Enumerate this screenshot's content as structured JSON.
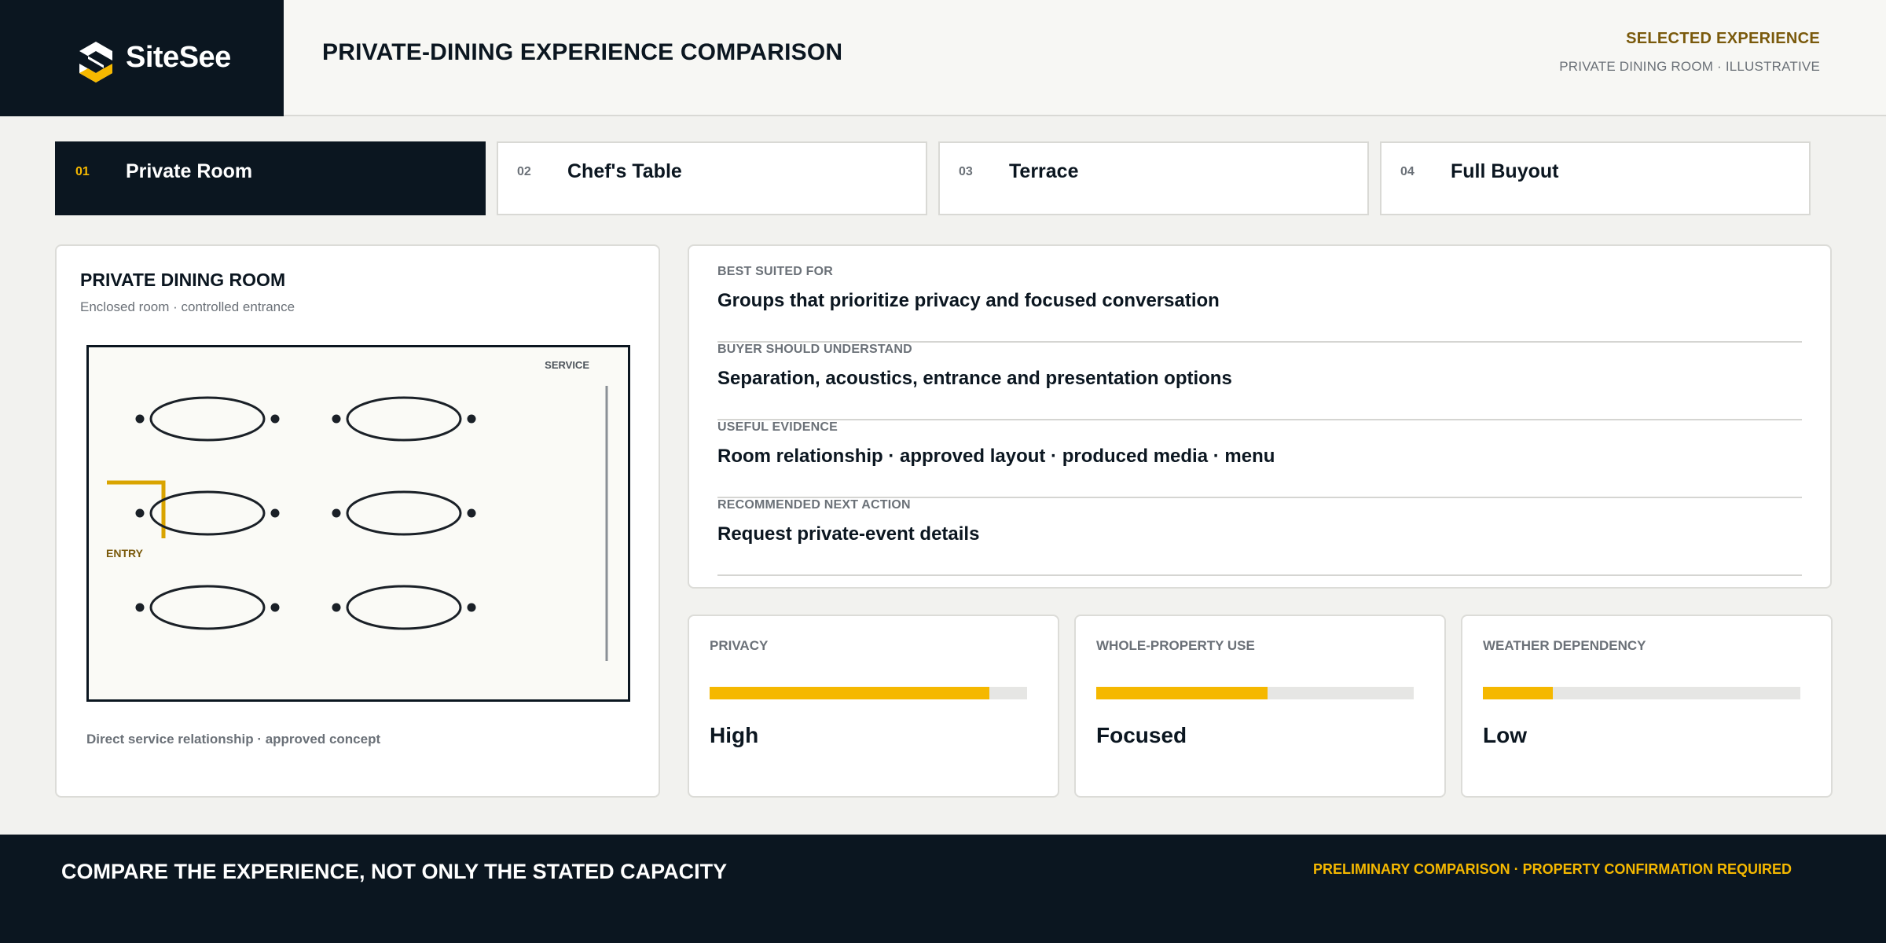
{
  "brand": {
    "name": "SiteSee",
    "logo_icon": "sitesee-logo-icon",
    "accent_color": "#f5b800",
    "dark_color": "#0b1620"
  },
  "header": {
    "title": "PRIVATE-DINING EXPERIENCE COMPARISON",
    "selected_label": "SELECTED EXPERIENCE",
    "selected_sub": "PRIVATE DINING ROOM · ILLUSTRATIVE"
  },
  "tabs": [
    {
      "num": "01",
      "label": "Private Room",
      "active": true
    },
    {
      "num": "02",
      "label": "Chef's Table",
      "active": false
    },
    {
      "num": "03",
      "label": "Terrace",
      "active": false
    },
    {
      "num": "04",
      "label": "Full Buyout",
      "active": false
    }
  ],
  "room": {
    "title": "PRIVATE DINING ROOM",
    "subtitle": "Enclosed room · controlled entrance",
    "caption": "Direct service relationship · approved concept",
    "plan": {
      "service_label": "SERVICE",
      "entry_label": "ENTRY"
    }
  },
  "info": [
    {
      "label": "BEST SUITED FOR",
      "value": "Groups that prioritize privacy and focused conversation"
    },
    {
      "label": "BUYER SHOULD UNDERSTAND",
      "value": "Separation, acoustics, entrance and presentation options"
    },
    {
      "label": "USEFUL EVIDENCE",
      "value": "Room relationship · approved layout · produced media · menu"
    },
    {
      "label": "RECOMMENDED NEXT ACTION",
      "value": "Request private-event details"
    }
  ],
  "metrics": [
    {
      "label": "PRIVACY",
      "value": "High",
      "level": 0.88
    },
    {
      "label": "WHOLE-PROPERTY USE",
      "value": "Focused",
      "level": 0.54
    },
    {
      "label": "WEATHER DEPENDENCY",
      "value": "Low",
      "level": 0.22
    }
  ],
  "footer": {
    "left": "COMPARE THE EXPERIENCE, NOT ONLY THE STATED CAPACITY",
    "right": "PRELIMINARY COMPARISON · PROPERTY CONFIRMATION REQUIRED"
  }
}
